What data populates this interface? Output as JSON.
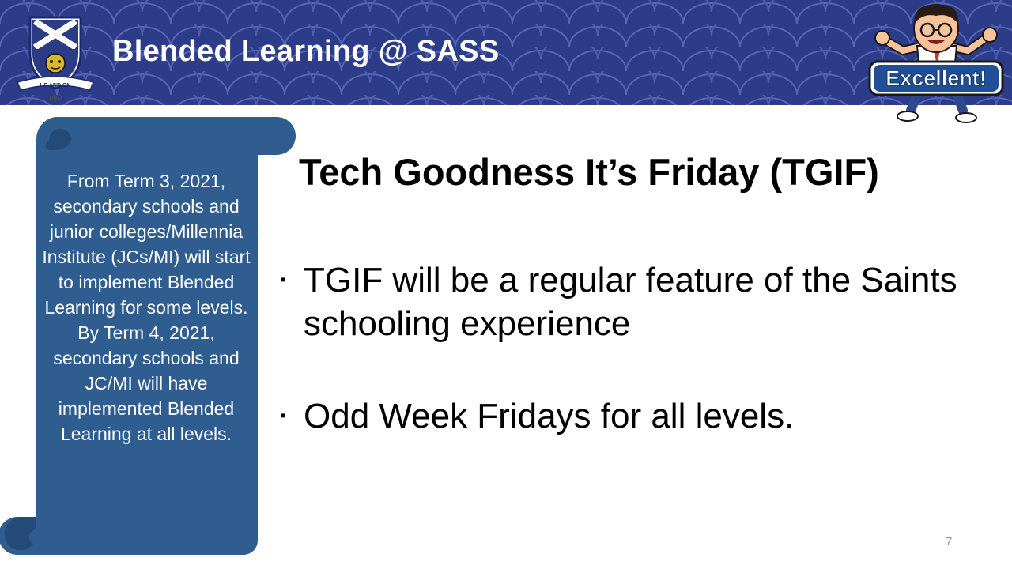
{
  "header": {
    "title": "Blended Learning @ SASS",
    "crest_motto": "UP AND ON",
    "crest_year": "1862",
    "mascot_badge": "Excellent!"
  },
  "sidebar_note": {
    "text": "From Term 3, 2021, secondary schools and junior colleges/Millennia Institute (JCs/MI) will start to implement Blended Learning for some levels. By Term 4, 2021, secondary schools and JC/MI will have implemented Blended Learning at all levels."
  },
  "slide": {
    "title": "Tech Goodness It’s Friday (TGIF)",
    "stray_mark": ".",
    "bullet_marker": "▪",
    "bullets": [
      "TGIF will be a regular feature of the Saints schooling experience",
      "Odd Week Fridays for all levels."
    ],
    "page_number": "7"
  },
  "colors": {
    "banner": "#2b3b86",
    "banner_scale": "#3a4b9e",
    "scroll": "#2f5d8f"
  }
}
